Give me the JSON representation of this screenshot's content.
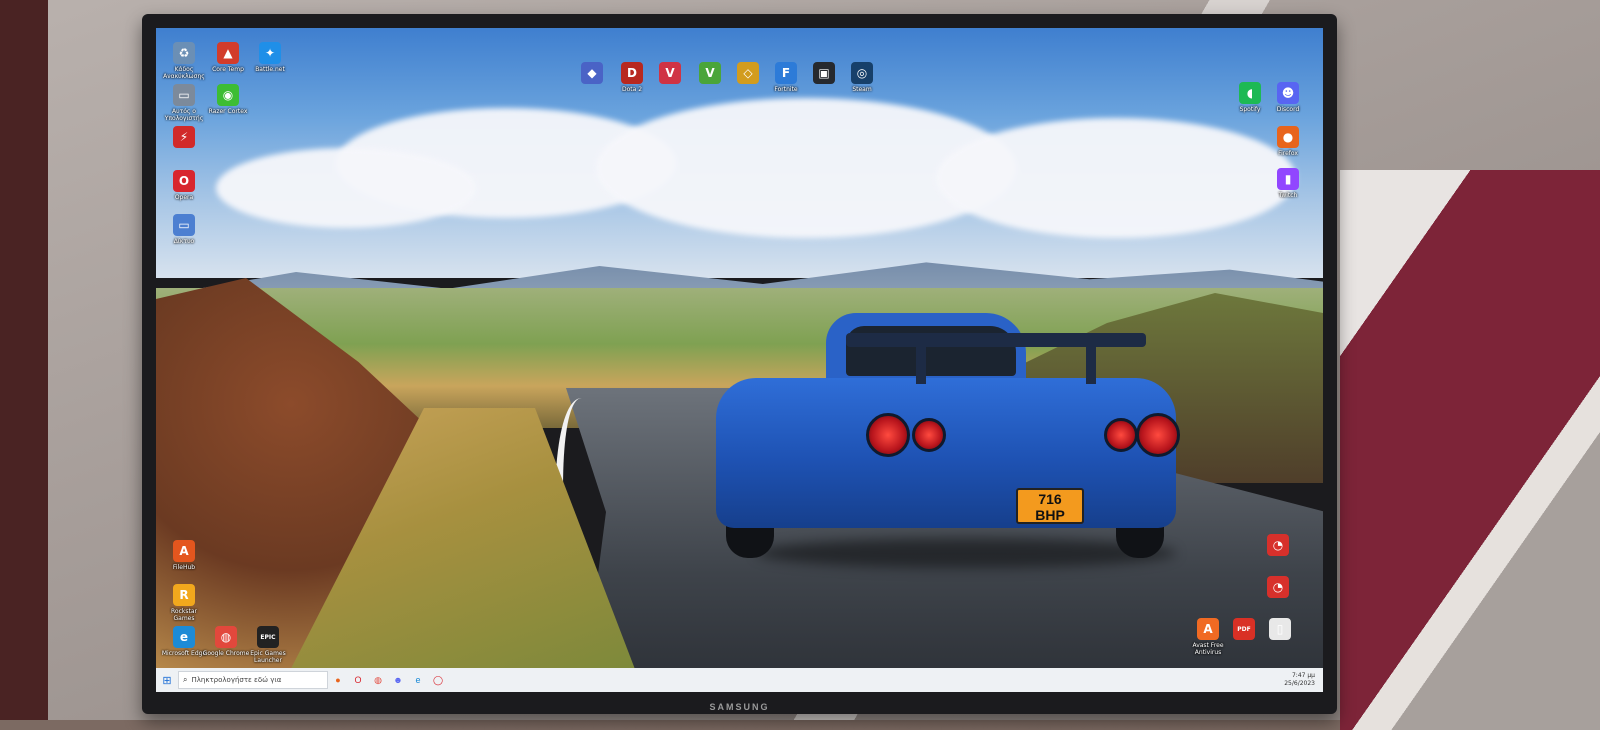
{
  "monitor": {
    "brand": "SAMSUNG"
  },
  "car": {
    "plate_line1": "716",
    "plate_line2": "BHP"
  },
  "desktop": {
    "icons": [
      {
        "id": "recycle-bin",
        "label": "Κάδος Ανακύκλωσης",
        "glyph": "♻",
        "color": "#6b8fb5"
      },
      {
        "id": "core-temp",
        "label": "Core Temp",
        "glyph": "▲",
        "color": "#d23c2b"
      },
      {
        "id": "battlenet",
        "label": "Battle.net",
        "glyph": "✦",
        "color": "#1f8fe8"
      },
      {
        "id": "hp-app",
        "label": "Αυτός ο Υπολογιστής",
        "glyph": "▭",
        "color": "#7c8a9b"
      },
      {
        "id": "razer-cortex",
        "label": "Razer Cortex",
        "glyph": "◉",
        "color": "#3dbd34"
      },
      {
        "id": "msi-afterburner",
        "label": "",
        "glyph": "⚡",
        "color": "#d12a2a"
      },
      {
        "id": "opera",
        "label": "Opera",
        "glyph": "O",
        "color": "#d8262e"
      },
      {
        "id": "folder",
        "label": "Δίκτυο",
        "glyph": "▭",
        "color": "#4c7fd1"
      },
      {
        "id": "game-1",
        "label": "",
        "glyph": "◆",
        "color": "#4a63c6"
      },
      {
        "id": "dota",
        "label": "Dota 2",
        "glyph": "D",
        "color": "#b8281f"
      },
      {
        "id": "valorant",
        "label": "",
        "glyph": "V",
        "color": "#d03344"
      },
      {
        "id": "gta",
        "label": "",
        "glyph": "V",
        "color": "#4aa53a"
      },
      {
        "id": "game-5",
        "label": "",
        "glyph": "◇",
        "color": "#d29c1e"
      },
      {
        "id": "fortnite",
        "label": "Fortnite",
        "glyph": "F",
        "color": "#2d7bd8"
      },
      {
        "id": "game-7",
        "label": "",
        "glyph": "▣",
        "color": "#26292e"
      },
      {
        "id": "steam",
        "label": "Steam",
        "glyph": "◎",
        "color": "#17406a"
      },
      {
        "id": "spotify",
        "label": "Spotify",
        "glyph": "◖",
        "color": "#1db954"
      },
      {
        "id": "discord",
        "label": "Discord",
        "glyph": "☻",
        "color": "#5865f2"
      },
      {
        "id": "firefox",
        "label": "Firefox",
        "glyph": "●",
        "color": "#e8641c"
      },
      {
        "id": "twitch",
        "label": "Twitch",
        "glyph": "▮",
        "color": "#9146ff"
      },
      {
        "id": "filehub",
        "label": "FileHub",
        "glyph": "A",
        "color": "#e4561e"
      },
      {
        "id": "rockstar",
        "label": "Rockstar Games",
        "glyph": "R",
        "color": "#f2a81d"
      },
      {
        "id": "edge",
        "label": "Microsoft Edge",
        "glyph": "e",
        "color": "#1d8bd6"
      },
      {
        "id": "chrome",
        "label": "Google Chrome",
        "glyph": "◍",
        "color": "#e2483c"
      },
      {
        "id": "epic",
        "label": "Epic Games Launcher",
        "glyph": "EPIC",
        "color": "#222"
      },
      {
        "id": "app-r1",
        "label": "",
        "glyph": "◔",
        "color": "#d7302b"
      },
      {
        "id": "app-r2",
        "label": "",
        "glyph": "◔",
        "color": "#d7302b"
      },
      {
        "id": "avast",
        "label": "Avast Free Antivirus",
        "glyph": "A",
        "color": "#f06a23"
      },
      {
        "id": "pdf",
        "label": "",
        "glyph": "PDF",
        "color": "#d93025"
      },
      {
        "id": "doc",
        "label": "",
        "glyph": "▯",
        "color": "#e8e8e8"
      }
    ]
  },
  "taskbar": {
    "search_placeholder": "Πληκτρολογήστε εδώ για",
    "apps": [
      "firefox",
      "opera",
      "chrome",
      "discord",
      "edge",
      "opera-gx"
    ],
    "clock_time": "7:47 μμ",
    "clock_date": "25/6/2023"
  }
}
